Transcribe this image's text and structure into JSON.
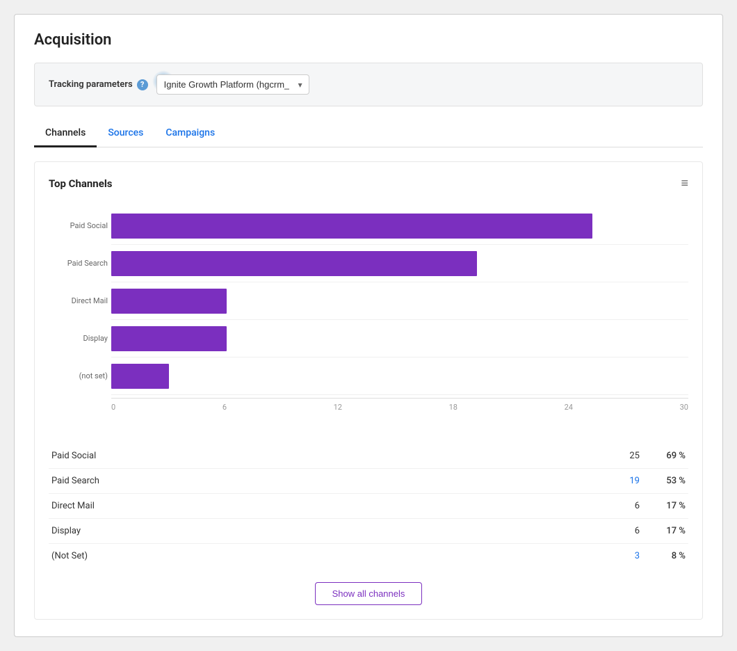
{
  "page": {
    "title": "Acquisition"
  },
  "tracking": {
    "label": "Tracking parameters",
    "help_symbol": "?",
    "dropdown_value": "Ignite Growth Platform (hgcrm_)"
  },
  "tabs": [
    {
      "id": "channels",
      "label": "Channels",
      "active": true
    },
    {
      "id": "sources",
      "label": "Sources",
      "active": false
    },
    {
      "id": "campaigns",
      "label": "Campaigns",
      "active": false
    }
  ],
  "chart": {
    "title": "Top Channels",
    "bars": [
      {
        "label": "Paid Social",
        "value": 25,
        "max": 30
      },
      {
        "label": "Paid Search",
        "value": 19,
        "max": 30
      },
      {
        "label": "Direct Mail",
        "value": 6,
        "max": 30
      },
      {
        "label": "Display",
        "value": 6,
        "max": 30
      },
      {
        "label": "(not set)",
        "value": 3,
        "max": 30
      }
    ],
    "x_axis": [
      "0",
      "6",
      "12",
      "18",
      "24",
      "30"
    ]
  },
  "table": {
    "rows": [
      {
        "name": "Paid Social",
        "count": "25",
        "pct": "69 %",
        "count_colored": false
      },
      {
        "name": "Paid Search",
        "count": "19",
        "pct": "53 %",
        "count_colored": true
      },
      {
        "name": "Direct Mail",
        "count": "6",
        "pct": "17 %",
        "count_colored": false
      },
      {
        "name": "Display",
        "count": "6",
        "pct": "17 %",
        "count_colored": false
      },
      {
        "name": "(Not Set)",
        "count": "3",
        "pct": "8 %",
        "count_colored": true
      }
    ],
    "show_all_label": "Show all channels"
  },
  "colors": {
    "bar_fill": "#7b2fbf",
    "accent_blue": "#1a73e8",
    "tab_active_border": "#222"
  }
}
